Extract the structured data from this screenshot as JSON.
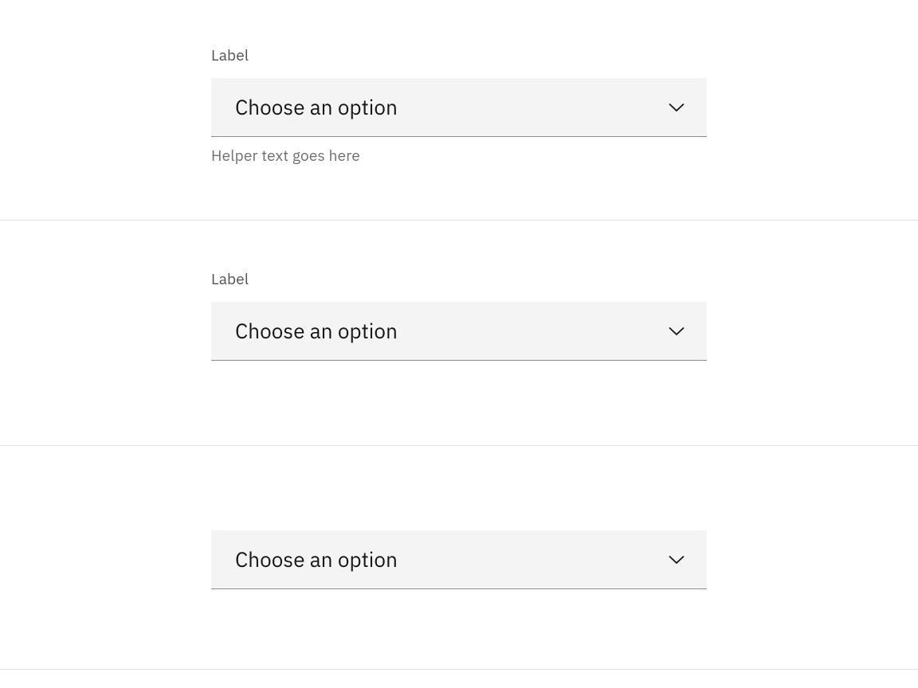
{
  "dropdowns": [
    {
      "label": "Label",
      "placeholder": "Choose an option",
      "helper": "Helper text goes here",
      "hasLabel": true,
      "hasHelper": true
    },
    {
      "label": "Label",
      "placeholder": "Choose an option",
      "hasLabel": true,
      "hasHelper": false
    },
    {
      "placeholder": "Choose an option",
      "hasLabel": false,
      "hasHelper": false
    }
  ]
}
